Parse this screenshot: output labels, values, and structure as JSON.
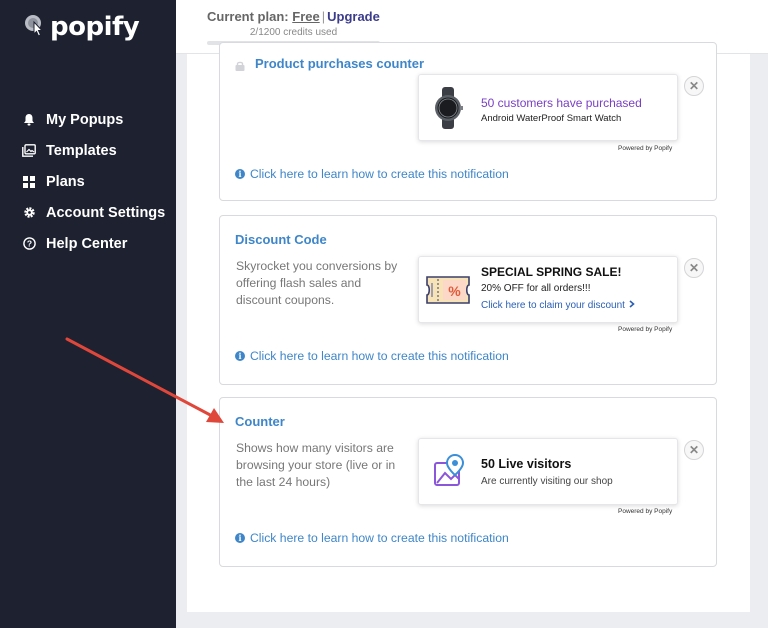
{
  "brand": {
    "name": "popify"
  },
  "sidebar": {
    "items": [
      {
        "label": "My Popups",
        "icon": "bell-icon"
      },
      {
        "label": "Templates",
        "icon": "image-gallery-icon"
      },
      {
        "label": "Plans",
        "icon": "grid-icon"
      },
      {
        "label": "Account Settings",
        "icon": "gear-icon"
      },
      {
        "label": "Help Center",
        "icon": "help-circle-icon"
      }
    ]
  },
  "topbar": {
    "plan_prefix": "Current plan:",
    "plan_name": "Free",
    "separator": "|",
    "upgrade_label": "Upgrade",
    "credits_text": "2/1200 credits used",
    "credits_used": 2,
    "credits_total": 1200
  },
  "cards": [
    {
      "title": "Product purchases counter",
      "description": "",
      "preview": {
        "headline": "50 customers have purchased",
        "subline": "Android WaterProof Smart Watch",
        "image": "smart-watch-image"
      },
      "powered_by": "Powered by Popify",
      "learn_link": "Click here to learn how to create this notification"
    },
    {
      "title": "Discount Code",
      "description": "Skyrocket you conversions by offering flash sales and discount coupons.",
      "preview": {
        "headline": "SPECIAL SPRING SALE!",
        "subline": "20% OFF for all orders!!!",
        "link": "Click here to claim your discount",
        "image": "coupon-icon"
      },
      "powered_by": "Powered by Popify",
      "learn_link": "Click here to learn how to create this notification"
    },
    {
      "title": "Counter",
      "description": "Shows how many visitors are browsing your store (live or in the last 24 hours)",
      "preview": {
        "headline": "50 Live visitors",
        "subline": "Are currently visiting our shop",
        "image": "map-pin-icon"
      },
      "powered_by": "Powered by Popify",
      "learn_link": "Click here to learn how to create this notification"
    }
  ],
  "colors": {
    "sidebar_bg": "#1d2130",
    "link_blue": "#3e86c9",
    "purple_headline": "#7a3fc4",
    "annotation_arrow": "#e0473b"
  }
}
